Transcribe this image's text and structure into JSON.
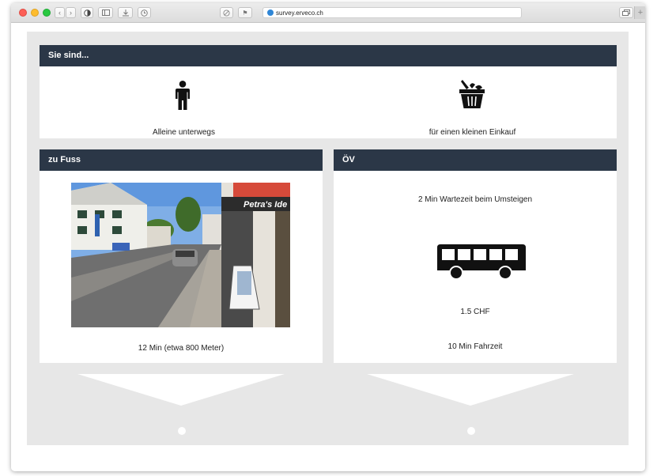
{
  "browser": {
    "url": "survey.erveco.ch"
  },
  "panels": {
    "situation": {
      "title": "Sie sind...",
      "option_left": "Alleine unterwegs",
      "option_right": "für einen kleinen Einkauf"
    },
    "walk": {
      "title": "zu Fuss",
      "photo_sign": "Petra's Ide",
      "duration": "12 Min (etwa 800 Meter)"
    },
    "transit": {
      "title": "ÖV",
      "transfer_wait": "2 Min Wartezeit beim Umsteigen",
      "price": "1.5 CHF",
      "ride_time": "10 Min Fahrzeit"
    }
  },
  "icons": {
    "person": "person-icon",
    "basket": "shopping-basket-icon",
    "bus": "bus-icon"
  },
  "colors": {
    "header_bg": "#2b3747",
    "survey_bg": "#e7e7e7"
  }
}
